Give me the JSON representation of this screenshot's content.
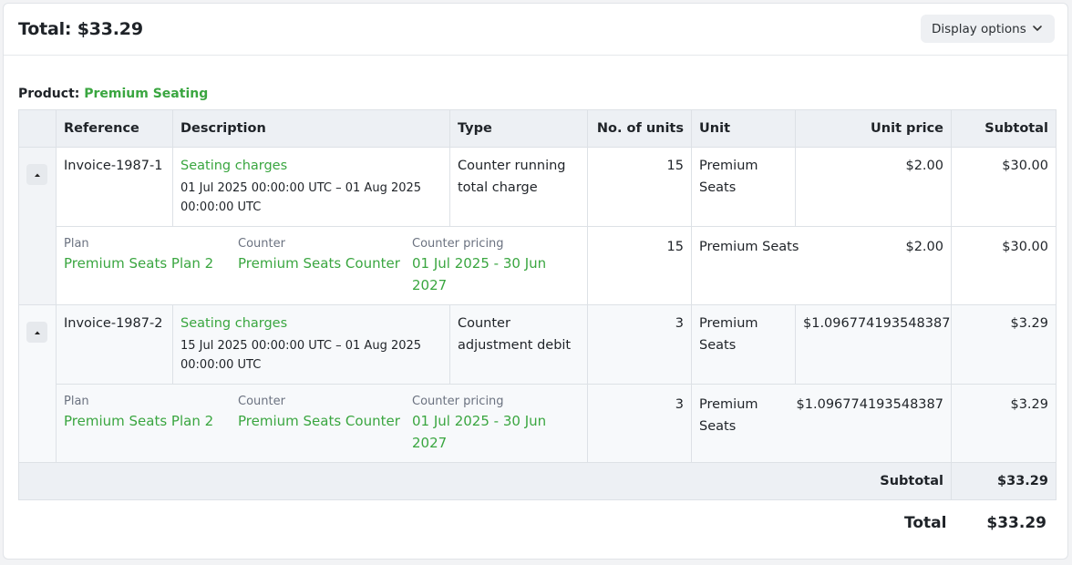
{
  "header": {
    "total_label": "Total: $33.29",
    "display_options_label": "Display options"
  },
  "product": {
    "label": "Product:",
    "name": "Premium Seating"
  },
  "table": {
    "columns": [
      "Reference",
      "Description",
      "Type",
      "No. of units",
      "Unit",
      "Unit price",
      "Subtotal"
    ],
    "rows": [
      {
        "reference": "Invoice-1987-1",
        "description": "Seating charges",
        "period": "01 Jul 2025 00:00:00 UTC – 01 Aug 2025 00:00:00 UTC",
        "type": "Counter running total charge",
        "units": "15",
        "unit": "Premium Seats",
        "unit_price": "$2.00",
        "subtotal": "$30.00",
        "detail": {
          "plan_label": "Plan",
          "plan": "Premium Seats Plan 2",
          "counter_label": "Counter",
          "counter": "Premium Seats Counter",
          "pricing_label": "Counter pricing",
          "pricing": "01 Jul 2025 - 30 Jun 2027",
          "units": "15",
          "unit": "Premium Seats",
          "unit_price": "$2.00",
          "subtotal": "$30.00"
        }
      },
      {
        "reference": "Invoice-1987-2",
        "description": "Seating charges",
        "period": "15 Jul 2025 00:00:00 UTC – 01 Aug 2025 00:00:00 UTC",
        "type": "Counter adjustment debit",
        "units": "3",
        "unit": "Premium Seats",
        "unit_price": "$1.096774193548387",
        "subtotal": "$3.29",
        "detail": {
          "plan_label": "Plan",
          "plan": "Premium Seats Plan 2",
          "counter_label": "Counter",
          "counter": "Premium Seats Counter",
          "pricing_label": "Counter pricing",
          "pricing": "01 Jul 2025 - 30 Jun 2027",
          "units": "3",
          "unit": "Premium Seats",
          "unit_price": "$1.096774193548387",
          "subtotal": "$3.29"
        }
      }
    ],
    "subtotal_label": "Subtotal",
    "subtotal_value": "$33.29"
  },
  "footer": {
    "total_label": "Total",
    "total_value": "$33.29"
  },
  "colors": {
    "accent_green": "#3aa640",
    "header_bg": "#edf0f4"
  },
  "icons": {
    "display_options": "chevron-down-icon",
    "expander": "caret-up-icon"
  }
}
